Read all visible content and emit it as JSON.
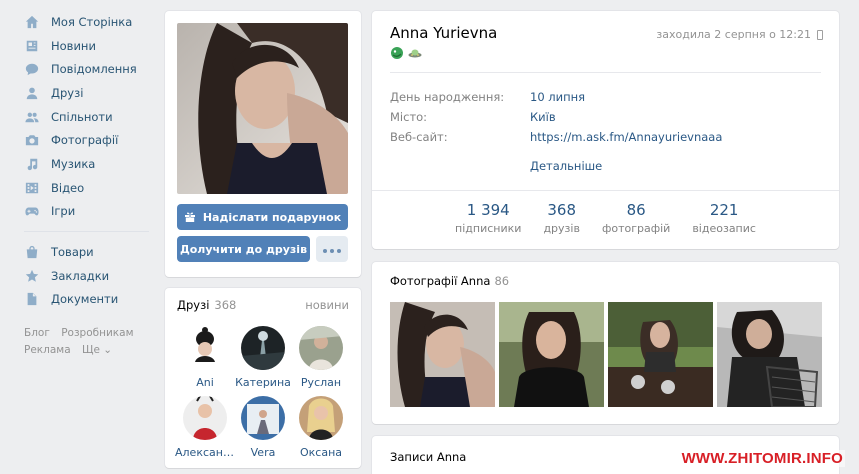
{
  "sidebar": {
    "items": [
      {
        "label": "Моя Сторінка",
        "icon": "home-icon"
      },
      {
        "label": "Новини",
        "icon": "news-icon"
      },
      {
        "label": "Повідомлення",
        "icon": "message-icon"
      },
      {
        "label": "Друзі",
        "icon": "user-icon"
      },
      {
        "label": "Спільноти",
        "icon": "users-icon"
      },
      {
        "label": "Фотографії",
        "icon": "camera-icon"
      },
      {
        "label": "Музика",
        "icon": "music-icon"
      },
      {
        "label": "Відео",
        "icon": "video-icon"
      },
      {
        "label": "Ігри",
        "icon": "gamepad-icon"
      }
    ],
    "items2": [
      {
        "label": "Товари",
        "icon": "bag-icon"
      },
      {
        "label": "Закладки",
        "icon": "star-icon"
      },
      {
        "label": "Документи",
        "icon": "document-icon"
      }
    ],
    "footer": {
      "blog": "Блог",
      "dev": "Розробникам",
      "ads": "Реклама",
      "more": "Ще ⌄"
    }
  },
  "avatar_card": {
    "gift_button": "Надіслати подарунок",
    "add_friend_button": "Долучити до друзів"
  },
  "friends": {
    "title": "Друзі",
    "count": "368",
    "new_link": "нoвини",
    "list": [
      {
        "name": "Ani"
      },
      {
        "name": "Катерина"
      },
      {
        "name": "Руслан"
      },
      {
        "name": "Александ..."
      },
      {
        "name": "Vera"
      },
      {
        "name": "Оксана"
      }
    ]
  },
  "profile": {
    "name": "Anna Yurievna",
    "last_seen": "заходила 2 серпня о 12:21",
    "info": [
      {
        "key": "День народження:",
        "value": "10 липня"
      },
      {
        "key": "Місто:",
        "value": "Київ"
      },
      {
        "key": "Веб-сайт:",
        "value": "https://m.ask.fm/Annayurievnaaa"
      }
    ],
    "more_link": "Детальніше",
    "counters": [
      {
        "number": "1 394",
        "label": "підписники"
      },
      {
        "number": "368",
        "label": "друзів"
      },
      {
        "number": "86",
        "label": "фотографій"
      },
      {
        "number": "221",
        "label": "відеозапис"
      }
    ]
  },
  "photos": {
    "title": "Фотографії Anna",
    "count": "86"
  },
  "posts": {
    "title": "Записи Anna"
  },
  "watermark": "WWW.ZHITOMIR.INFO",
  "colors": {
    "accent": "#5181b8",
    "link": "#2a5885",
    "background": "#edeef0",
    "watermark": "#d81f26"
  }
}
